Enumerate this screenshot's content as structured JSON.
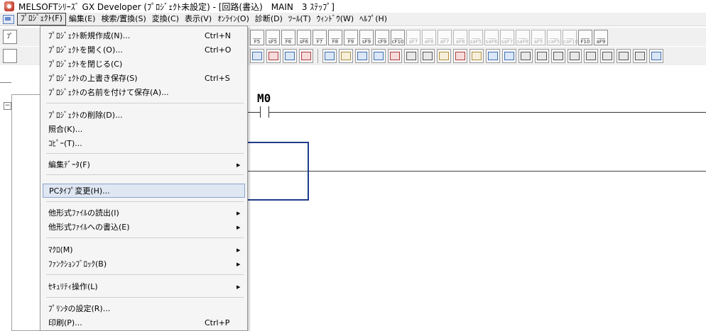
{
  "window": {
    "title": "MELSOFTｼﾘｰｽﾞ GX Developer (ﾌﾟﾛｼﾞｪｸﾄ未設定) - [回路(書込)　MAIN　3 ｽﾃｯﾌﾟ]"
  },
  "menubar": {
    "items": [
      "ﾌﾟﾛｼﾞｪｸﾄ(F)",
      "編集(E)",
      "検索/置換(S)",
      "変換(C)",
      "表示(V)",
      "ｵﾝﾗｲﾝ(O)",
      "診断(D)",
      "ﾂｰﾙ(T)",
      "ｳｨﾝﾄﾞｳ(W)",
      "ﾍﾙﾌﾟ(H)"
    ]
  },
  "toolbar": {
    "left_glyph": "ﾌﾟ",
    "function_keys": [
      "F5",
      "sF5",
      "F6",
      "sF6",
      "F7",
      "F8",
      "F9",
      "sF9",
      "cF9",
      "cF10",
      "aF7",
      "aF8",
      "aF7",
      "aF8",
      "saF5",
      "saF6",
      "saF7",
      "saF8",
      "aF5",
      "caF5",
      "caF10",
      "F10",
      "aF9"
    ]
  },
  "ladder": {
    "device_label": "M0"
  },
  "project_menu": {
    "items": [
      {
        "label": "ﾌﾟﾛｼﾞｪｸﾄ新規作成(N)...",
        "shortcut": "Ctrl+N"
      },
      {
        "label": "ﾌﾟﾛｼﾞｪｸﾄを開く(O)...",
        "shortcut": "Ctrl+O"
      },
      {
        "label": "ﾌﾟﾛｼﾞｪｸﾄを閉じる(C)",
        "shortcut": ""
      },
      {
        "label": "ﾌﾟﾛｼﾞｪｸﾄの上書き保存(S)",
        "shortcut": "Ctrl+S"
      },
      {
        "label": "ﾌﾟﾛｼﾞｪｸﾄの名前を付けて保存(A)...",
        "shortcut": ""
      },
      {
        "label": "ﾌﾟﾛｼﾞｪｸﾄの削除(D)...",
        "shortcut": ""
      },
      {
        "label": "照合(K)...",
        "shortcut": ""
      },
      {
        "label": "ｺﾋﾟｰ(T)...",
        "shortcut": ""
      },
      {
        "label": "編集ﾃﾞｰﾀ(F)",
        "shortcut": ""
      },
      {
        "label": "PCﾀｲﾌﾟ変更(H)...",
        "shortcut": ""
      },
      {
        "label": "他形式ﾌｧｲﾙの読出(I)",
        "shortcut": ""
      },
      {
        "label": "他形式ﾌｧｲﾙへの書込(E)",
        "shortcut": ""
      },
      {
        "label": "ﾏｸﾛ(M)",
        "shortcut": ""
      },
      {
        "label": "ﾌｧﾝｸｼｮﾝﾌﾞﾛｯｸ(B)",
        "shortcut": ""
      },
      {
        "label": "ｾｷｭﾘﾃｨ操作(L)",
        "shortcut": ""
      },
      {
        "label": "ﾌﾟﾘﾝﾀの設定(R)...",
        "shortcut": ""
      },
      {
        "label": "印刷(P)...",
        "shortcut": "Ctrl+P"
      }
    ]
  },
  "colors": {
    "cursor": "#1f3c8c",
    "highlight": "#dfe7f3"
  }
}
